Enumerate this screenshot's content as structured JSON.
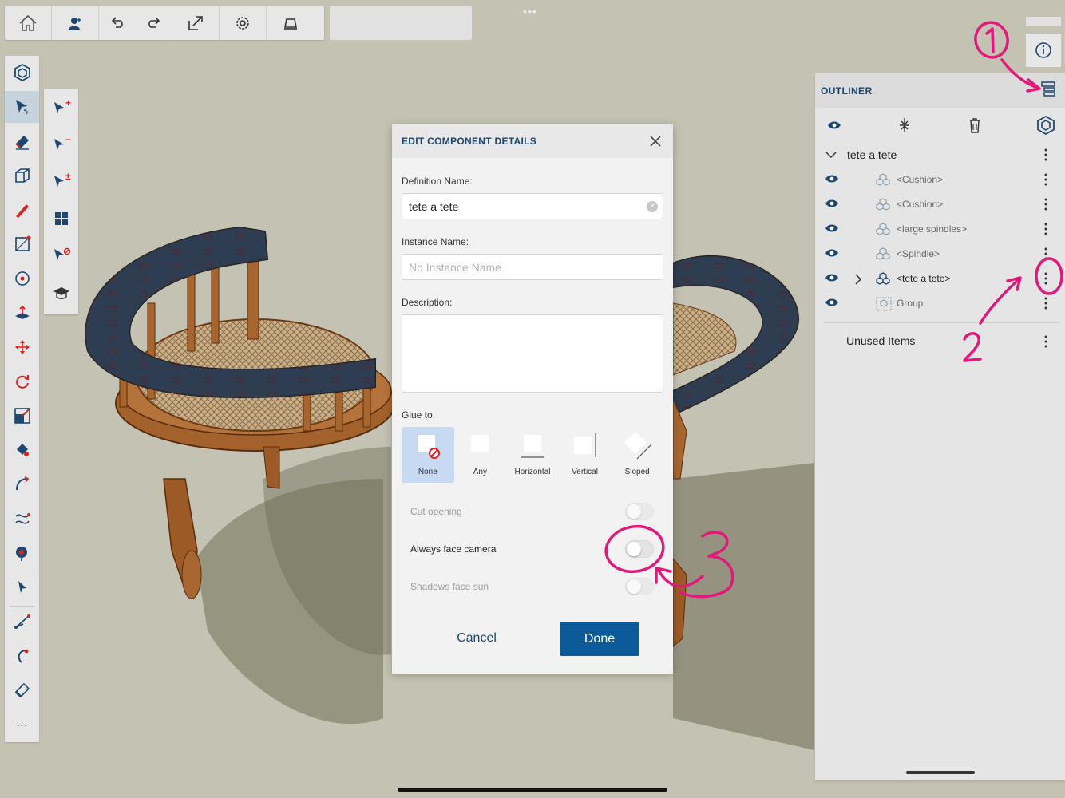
{
  "top_toolbar": {
    "icons": [
      "home-icon",
      "profile-icon",
      "undo-icon",
      "redo-icon",
      "export-icon",
      "settings-icon",
      "xray-icon"
    ],
    "grip": "•••"
  },
  "left_toolbar": {
    "icons": [
      "components-icon",
      "select-tool-icon",
      "eraser-icon",
      "box-icon",
      "pencil-icon",
      "rectangle-icon",
      "circle-icon",
      "push-pull-icon",
      "move-icon",
      "rotate-icon",
      "scale-icon",
      "paint-bucket-icon",
      "follow-me-icon",
      "path-icon",
      "tape-measure-icon",
      "pointer-icon",
      "arc-icon",
      "offset-icon",
      "tag-icon",
      "more-icon"
    ],
    "more_label": "···"
  },
  "sub_toolbar": {
    "icons": [
      "select-add-icon",
      "select-subtract-icon",
      "select-toggle-icon",
      "select-all-icon",
      "select-none-icon",
      "learn-icon"
    ],
    "add_glyph": "+",
    "subtract_glyph": "−",
    "toggle_glyph": "±"
  },
  "dialog": {
    "title": "EDIT COMPONENT DETAILS",
    "definition_name_label": "Definition Name:",
    "definition_name_value": "tete a tete",
    "instance_name_label": "Instance Name:",
    "instance_name_placeholder": "No Instance Name",
    "description_label": "Description:",
    "glue_label": "Glue to:",
    "glue_options": [
      {
        "label": "None",
        "selected": true
      },
      {
        "label": "Any",
        "selected": false
      },
      {
        "label": "Horizontal",
        "selected": false
      },
      {
        "label": "Vertical",
        "selected": false
      },
      {
        "label": "Sloped",
        "selected": false
      }
    ],
    "toggles": [
      {
        "label": "Cut opening",
        "on": false,
        "enabled": false
      },
      {
        "label": "Always face camera",
        "on": false,
        "enabled": true
      },
      {
        "label": "Shadows face sun",
        "on": false,
        "enabled": false
      }
    ],
    "cancel_label": "Cancel",
    "done_label": "Done",
    "clear_glyph": "×"
  },
  "outliner": {
    "title": "OUTLINER",
    "tools": [
      "eye-icon",
      "collapse-icon",
      "trash-icon",
      "components-icon"
    ],
    "root": {
      "label": "tete a tete",
      "expanded": true
    },
    "items": [
      {
        "label": "<Cushion>",
        "type": "component",
        "expandable": false,
        "highlight": false
      },
      {
        "label": "<Cushion>",
        "type": "component",
        "expandable": false,
        "highlight": false
      },
      {
        "label": "<large spindles>",
        "type": "component",
        "expandable": false,
        "highlight": false
      },
      {
        "label": "<Spindle>",
        "type": "component",
        "expandable": false,
        "highlight": false
      },
      {
        "label": "<tete a tete>",
        "type": "component",
        "expandable": true,
        "highlight": true
      },
      {
        "label": "Group",
        "type": "group",
        "expandable": false,
        "highlight": false
      }
    ],
    "unused_label": "Unused Items"
  },
  "colors": {
    "accent": "#1c4770",
    "primary_button": "#0d5a9a",
    "selected_glue": "#c8daf2",
    "annotation": "#e0197a",
    "background": "#c4c2b2"
  }
}
